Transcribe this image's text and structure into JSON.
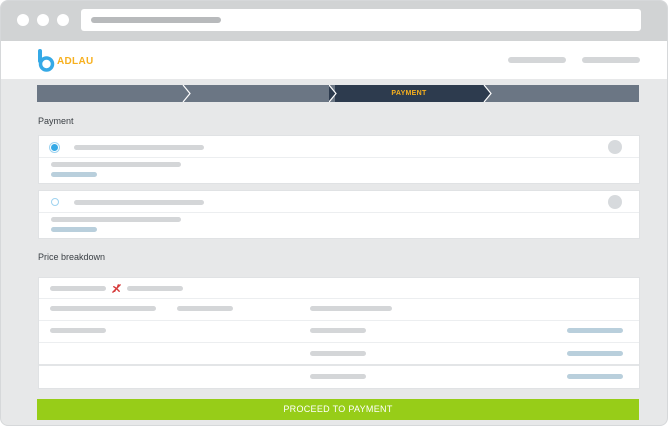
{
  "brand": {
    "name": "ADLAU",
    "mark": "b",
    "colors": {
      "blue": "#35a9e6",
      "orange": "#f7b01f",
      "green": "#97cd18",
      "navy": "#2d3b4e",
      "slate": "#6b7684"
    }
  },
  "progress": {
    "steps": [
      {
        "label": "",
        "state": "done"
      },
      {
        "label": "",
        "state": "done"
      },
      {
        "label": "PAYMENT",
        "state": "active"
      },
      {
        "label": "",
        "state": "todo"
      }
    ]
  },
  "payment": {
    "title": "Payment",
    "options": [
      {
        "selected": true
      },
      {
        "selected": false
      }
    ]
  },
  "price_breakdown": {
    "title": "Price breakdown",
    "icon": "plane-icon"
  },
  "cta": {
    "label": "PROCEED TO PAYMENT"
  }
}
